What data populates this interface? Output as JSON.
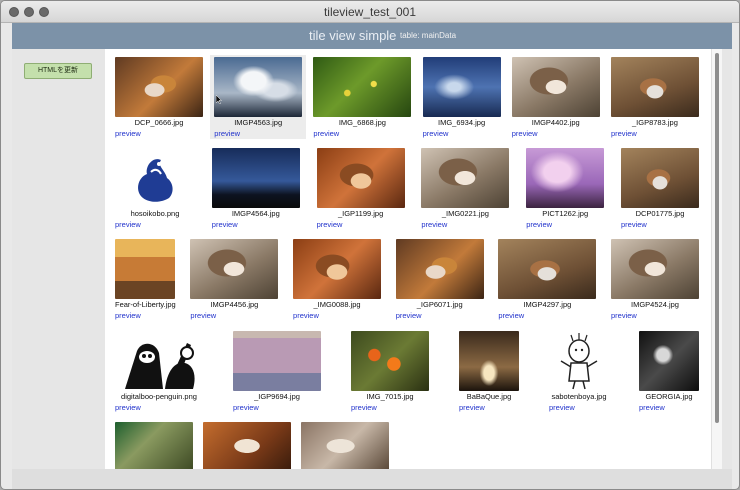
{
  "window": {
    "title": "tileview_test_001"
  },
  "header": {
    "title": "tile view simple",
    "table_label": "table: mainData"
  },
  "sidebar": {
    "refresh_button": "HTMLを更新"
  },
  "preview_label": "preview",
  "rows": [
    [
      {
        "name": "DCP_0666.jpg",
        "thumb_icon": "cat-photo"
      },
      {
        "name": "IMGP4563.jpg",
        "thumb_icon": "sky-photo"
      },
      {
        "name": "IMG_6868.jpg",
        "thumb_icon": "flower-field-photo"
      },
      {
        "name": "IMG_6934.jpg",
        "thumb_icon": "sky-photo"
      },
      {
        "name": "IMGP4402.jpg",
        "thumb_icon": "cat-photo"
      },
      {
        "name": "_IGP8783.jpg",
        "thumb_icon": "cat-photo"
      }
    ],
    [
      {
        "name": "hosoikobo.png",
        "thumb_icon": "logo"
      },
      {
        "name": "IMGP4564.jpg",
        "thumb_icon": "dusk-sky-photo"
      },
      {
        "name": "_IGP1199.jpg",
        "thumb_icon": "cat-photo"
      },
      {
        "name": "_IMG0221.jpg",
        "thumb_icon": "cat-photo"
      },
      {
        "name": "PICT1262.jpg",
        "thumb_icon": "blossom-photo"
      },
      {
        "name": "DCP01775.jpg",
        "thumb_icon": "cat-photo"
      }
    ],
    [
      {
        "name": "Fear-of-Liberty.jpg",
        "thumb_icon": "book-cover"
      },
      {
        "name": "IMGP4456.jpg",
        "thumb_icon": "cat-photo"
      },
      {
        "name": "_IMG0088.jpg",
        "thumb_icon": "cat-photo"
      },
      {
        "name": "_IGP6071.jpg",
        "thumb_icon": "cat-photo"
      },
      {
        "name": "IMGP4297.jpg",
        "thumb_icon": "cat-photo"
      },
      {
        "name": "IMGP4524.jpg",
        "thumb_icon": "cat-photo"
      }
    ],
    [
      {
        "name": "digitalboo-penguin.png",
        "thumb_icon": "cartoon"
      },
      {
        "name": "_IGP9694.jpg",
        "thumb_icon": "painting-photo"
      },
      {
        "name": "IMG_7015.jpg",
        "thumb_icon": "flower-photo"
      },
      {
        "name": "BaBaQue.jpg",
        "thumb_icon": "bar-photo"
      },
      {
        "name": "sabotenboya.jpg",
        "thumb_icon": "cartoon"
      },
      {
        "name": "GEORGIA.jpg",
        "thumb_icon": "bw-photo"
      }
    ],
    [
      {
        "name": "",
        "thumb_icon": "tree-photo"
      },
      {
        "name": "",
        "thumb_icon": "cat-photo"
      },
      {
        "name": "",
        "thumb_icon": "cat-photo"
      }
    ]
  ]
}
